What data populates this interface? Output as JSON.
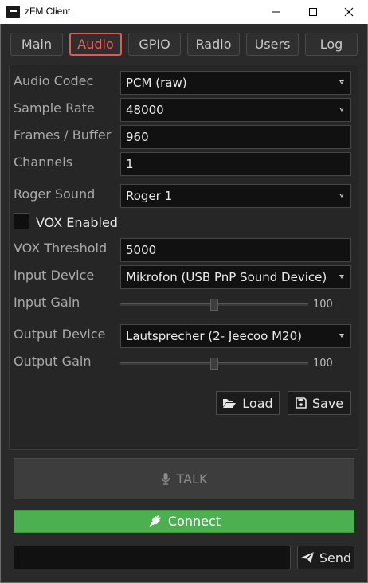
{
  "window": {
    "title": "zFM Client",
    "icons": {
      "app": "app-logo-icon",
      "minimize": "minimize-icon",
      "maximize": "maximize-icon",
      "close": "close-icon"
    }
  },
  "tabs": [
    {
      "label": "Main",
      "active": false
    },
    {
      "label": "Audio",
      "active": true
    },
    {
      "label": "GPIO",
      "active": false
    },
    {
      "label": "Radio",
      "active": false
    },
    {
      "label": "Users",
      "active": false
    },
    {
      "label": "Log",
      "active": false
    }
  ],
  "audio": {
    "codec": {
      "label": "Audio Codec",
      "value": "PCM (raw)"
    },
    "sample_rate": {
      "label": "Sample Rate",
      "value": "48000"
    },
    "frames_per_buffer": {
      "label": "Frames / Buffer",
      "value": "960"
    },
    "channels": {
      "label": "Channels",
      "value": "1"
    },
    "roger_sound": {
      "label": "Roger Sound",
      "value": "Roger 1"
    },
    "vox_enabled": {
      "label": "VOX Enabled",
      "checked": false
    },
    "vox_threshold": {
      "label": "VOX Threshold",
      "value": "5000"
    },
    "input_device": {
      "label": "Input Device",
      "value": "Mikrofon (USB PnP Sound Device)"
    },
    "input_gain": {
      "label": "Input Gain",
      "value": "100",
      "level_fraction": 0.5
    },
    "output_device": {
      "label": "Output Device",
      "value": "Lautsprecher (2- Jeecoo M20)"
    },
    "output_gain": {
      "label": "Output Gain",
      "value": "100",
      "level_fraction": 0.5
    },
    "load_label": "Load",
    "save_label": "Save"
  },
  "controls": {
    "talk_label": "TALK",
    "connect_label": "Connect",
    "message_value": "",
    "send_label": "Send"
  },
  "colors": {
    "accent_tab": "#e05a50",
    "connect": "#4caf50"
  }
}
